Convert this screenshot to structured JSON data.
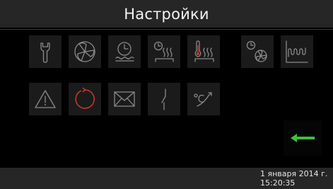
{
  "header": {
    "title": "Настройки"
  },
  "colors": {
    "background": "#000000",
    "bar": "#262626",
    "tile": "#1b1b1b",
    "icon_stroke": "#8a8a8a",
    "accent_green": "#3fbf3f",
    "accent_red": "#c83a2a"
  },
  "menu": {
    "row1": [
      {
        "icon": "wrench-icon"
      },
      {
        "icon": "fan-icon"
      },
      {
        "icon": "clock-water-icon"
      },
      {
        "icon": "clock-heating-icon"
      },
      {
        "icon": "thermometer-heating-icon"
      },
      {
        "icon": "clock-fan-icon"
      },
      {
        "icon": "wave-chart-icon"
      }
    ],
    "row2": [
      {
        "icon": "warning-icon"
      },
      {
        "icon": "reset-circle-icon"
      },
      {
        "icon": "envelope-icon"
      },
      {
        "icon": "switch-icon"
      },
      {
        "icon": "temperature-curve-icon"
      }
    ],
    "back": {
      "icon": "back-arrow-icon"
    }
  },
  "footer": {
    "date": "1 января 2014 г.",
    "time": "15:20:35"
  }
}
